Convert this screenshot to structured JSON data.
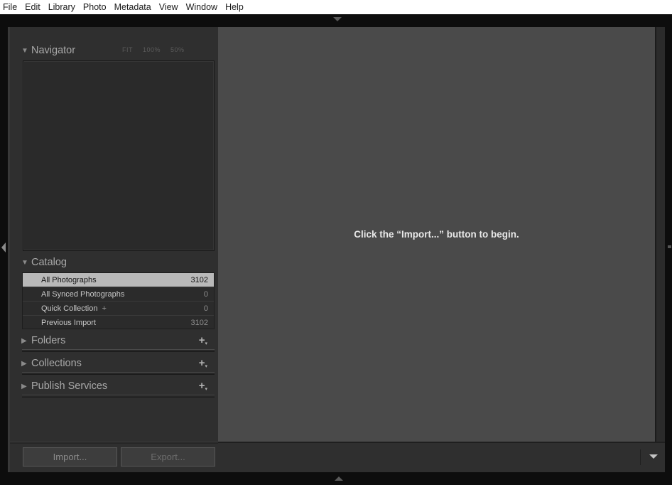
{
  "menubar": {
    "items": [
      "File",
      "Edit",
      "Library",
      "Photo",
      "Metadata",
      "View",
      "Window",
      "Help"
    ]
  },
  "navigator": {
    "title": "Navigator",
    "zoom_options": [
      "FIT",
      "100%",
      "50%"
    ]
  },
  "catalog": {
    "title": "Catalog",
    "rows": [
      {
        "label": "All Photographs",
        "count": "3102",
        "selected": true
      },
      {
        "label": "All Synced Photographs",
        "count": "0"
      },
      {
        "label": "Quick Collection",
        "plus": "+",
        "count": "0"
      },
      {
        "label": "Previous Import",
        "count": "3102"
      }
    ]
  },
  "sections": {
    "folders": "Folders",
    "collections": "Collections",
    "publish_services": "Publish Services"
  },
  "buttons": {
    "import": "Import...",
    "export": "Export..."
  },
  "main": {
    "message": "Click the “Import...” button to begin."
  },
  "colors": {
    "menubar_bg": "#ffffff",
    "panel_bg": "#2f2f2f",
    "main_bg": "#4a4a4a",
    "selected_row": "#b9b9b9"
  }
}
